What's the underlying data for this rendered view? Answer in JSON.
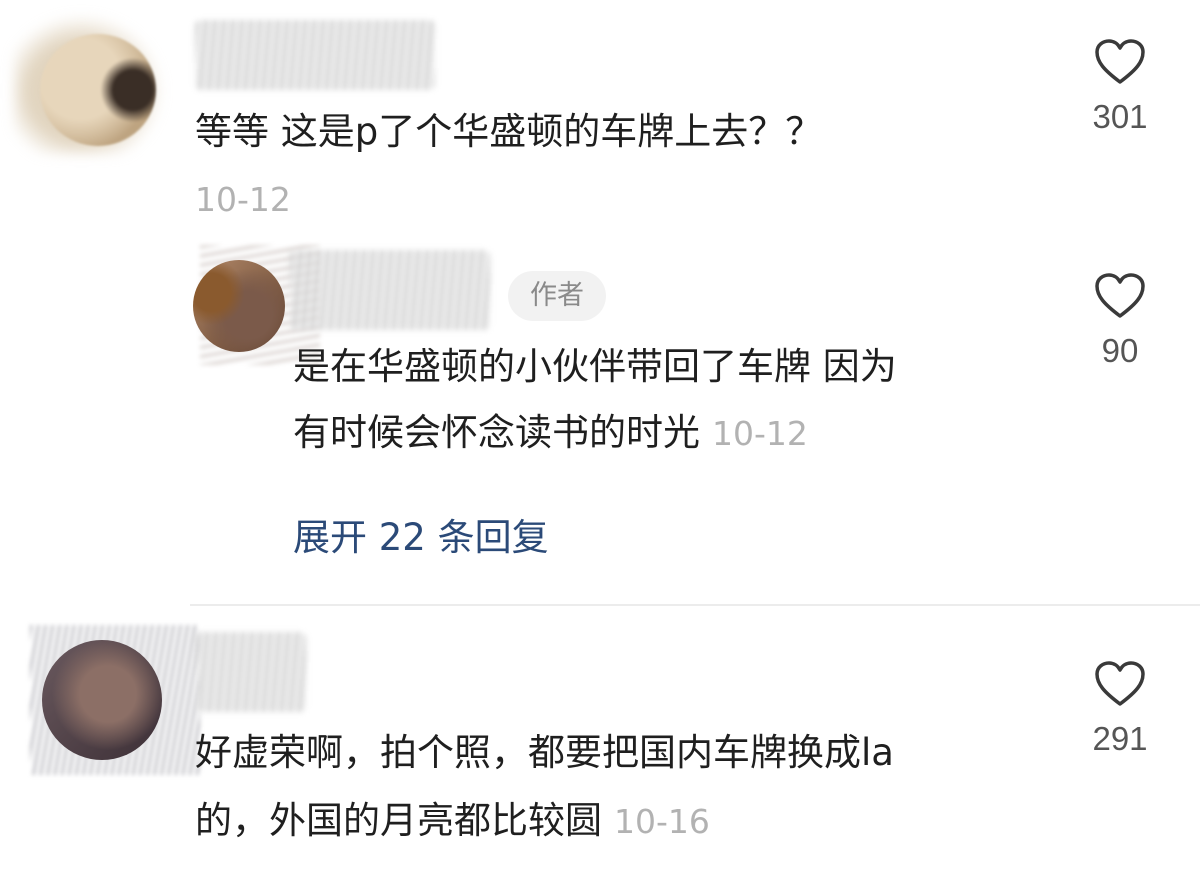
{
  "comments": [
    {
      "text": "等等 这是p了个华盛顿的车牌上去？？",
      "date": "10-12",
      "likes": "301",
      "replies": [
        {
          "badge": "作者",
          "text_line1": "是在华盛顿的小伙伴带回了车牌 因为",
          "text_line2": "有时候会怀念读书的时光",
          "date": "10-12",
          "likes": "90"
        }
      ],
      "expand_label": "展开 22 条回复"
    },
    {
      "text_line1": "好虚荣啊，拍个照，都要把国内车牌换成la",
      "text_line2": "的，外国的月亮都比较圆",
      "date": "10-16",
      "likes": "291"
    }
  ],
  "icons": {
    "like": "heart-outline-icon"
  },
  "colors": {
    "text": "#1f1f1f",
    "muted": "#b2b2b2",
    "link": "#2b4a78",
    "badge_bg": "#f2f2f2"
  }
}
